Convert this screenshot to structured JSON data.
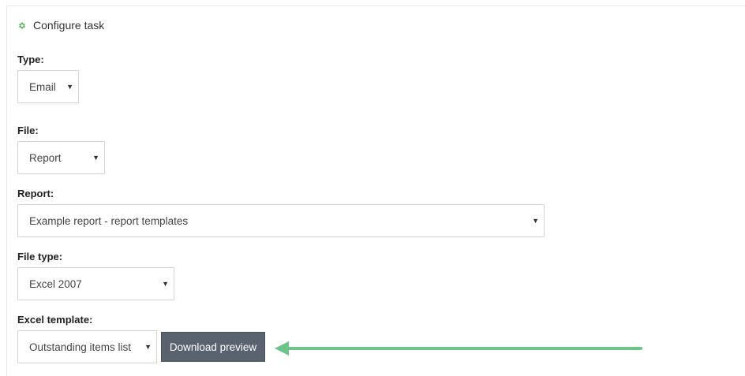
{
  "header": {
    "title": "Configure task",
    "icon": "gear-icon",
    "icon_color": "#5cb85c"
  },
  "fields": {
    "type": {
      "label": "Type:",
      "value": "Email"
    },
    "file": {
      "label": "File:",
      "value": "Report"
    },
    "report": {
      "label": "Report:",
      "value": "Example report - report templates"
    },
    "file_type": {
      "label": "File type:",
      "value": "Excel 2007"
    },
    "excel_template": {
      "label": "Excel template:",
      "value": "Outstanding items list"
    }
  },
  "buttons": {
    "download_preview": "Download preview"
  },
  "annotation": {
    "arrow_color": "#6cc488"
  }
}
